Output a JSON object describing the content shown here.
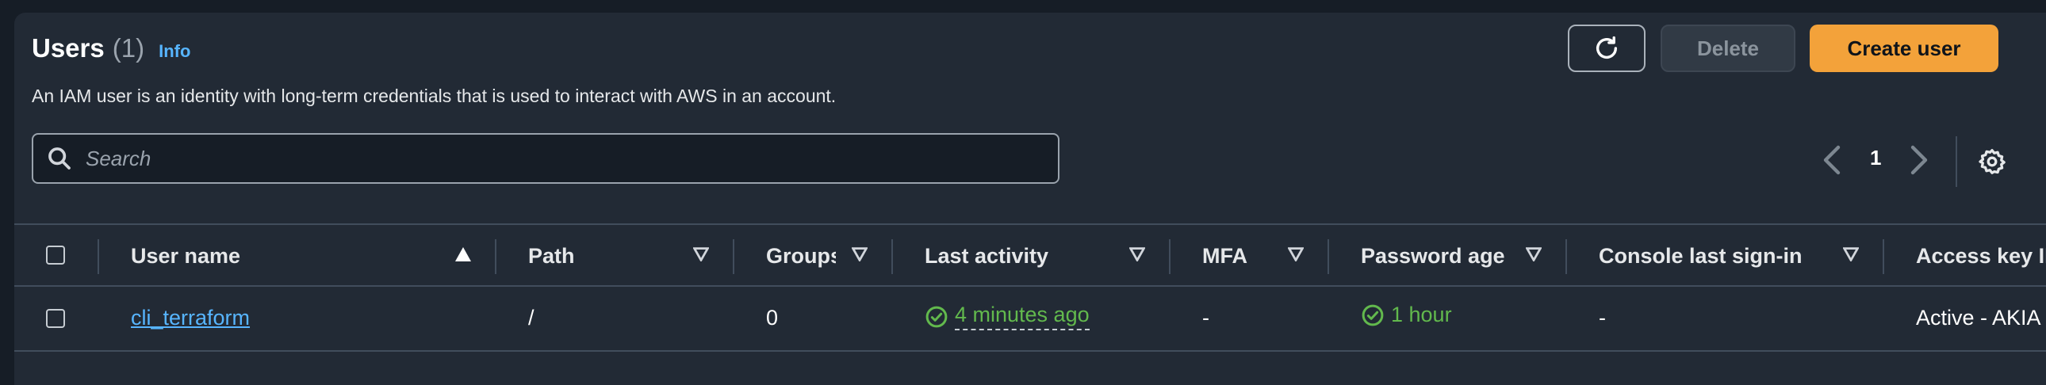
{
  "header": {
    "title": "Users",
    "count": "(1)",
    "info": "Info",
    "description": "An IAM user is an identity with long-term credentials that is used to interact with AWS in an account."
  },
  "toolbar": {
    "refresh_icon": "refresh-icon",
    "delete_label": "Delete",
    "create_label": "Create user"
  },
  "search": {
    "placeholder": "Search",
    "value": ""
  },
  "pagination": {
    "current_page": "1"
  },
  "table": {
    "columns": [
      "User name",
      "Path",
      "Groups",
      "Last activity",
      "MFA",
      "Password age",
      "Console last sign-in",
      "Access key ID"
    ],
    "rows": [
      {
        "user_name": "cli_terraform",
        "path": "/",
        "groups": "0",
        "last_activity": "4 minutes ago",
        "mfa": "-",
        "password_age": "1 hour",
        "console_last_sign_in": "-",
        "access_key": "Active - AKIA"
      }
    ]
  },
  "colors": {
    "background": "#161d26",
    "panel": "#222a35",
    "accent": "#f3a23a",
    "link": "#57b5ff",
    "success": "#62b94d"
  }
}
